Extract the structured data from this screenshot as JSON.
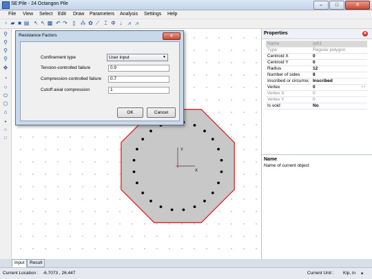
{
  "window": {
    "title": "SE:Pile - 24 Octangon Pile",
    "minimize": "–",
    "maximize": "□",
    "close": "✕"
  },
  "menu": [
    "File",
    "View",
    "Select",
    "Edit",
    "Draw",
    "Parameters",
    "Analysis",
    "Settings",
    "Help"
  ],
  "toolbar_icons": [
    "new-icon",
    "open-icon",
    "save-icon",
    "print-icon",
    "pointer-icon",
    "select-node-icon",
    "select-region-icon",
    "undo-icon",
    "redo-icon",
    "table-icon",
    "network-icon",
    "cluster-icon",
    "line-icon",
    "dimension-icon",
    "phi-icon",
    "arrow-down-icon",
    "chart-icon",
    "chart2-icon"
  ],
  "side_icons": [
    "zoom-in-icon",
    "zoom-out-icon",
    "zoom-fit-icon",
    "zoom-window-icon",
    "pan-icon",
    "rotate-icon",
    "circle-tool-icon",
    "ellipse-tool-icon",
    "polygon-tool-icon",
    "region-tool-icon",
    "point-tool-icon",
    "circle-pattern-icon",
    "grid-pattern-icon"
  ],
  "dialog": {
    "title": "Resistance Factors",
    "close": "✕",
    "fields": [
      {
        "label": "Confinement type",
        "value": "User input",
        "kind": "select"
      },
      {
        "label": "Tension-controlled failure",
        "value": "0.9",
        "kind": "input"
      },
      {
        "label": "Compression-controlled failure",
        "value": "0.7",
        "kind": "input"
      },
      {
        "label": "Cutoff axial compression",
        "value": "1",
        "kind": "input"
      }
    ],
    "ok": "OK",
    "cancel": "Cancel"
  },
  "properties": {
    "title": "Properties",
    "rows": [
      {
        "key": "Name",
        "value": "rp01",
        "dim": true,
        "sel": true
      },
      {
        "key": "Type",
        "value": "Regular polygon",
        "dim": true
      },
      {
        "key": "Centroid  X",
        "value": "0"
      },
      {
        "key": "Centroid  Y",
        "value": "0"
      },
      {
        "key": "Radius",
        "value": "12"
      },
      {
        "key": "Number of sides",
        "value": "8"
      },
      {
        "key": "Inscribed or circumscribed",
        "value": "Inscribed"
      },
      {
        "key": "Vertex",
        "value": "0",
        "spin": "‹ ›"
      },
      {
        "key": "Vertex X",
        "value": "0",
        "dim": true
      },
      {
        "key": "Vertex Y",
        "value": "0",
        "dim": true
      },
      {
        "key": "Is void",
        "value": "No"
      }
    ],
    "desc_title": "Name",
    "desc_text": "Name of current object"
  },
  "canvas": {
    "axis_x": "X",
    "axis_y": "Y",
    "polygon_sides": 8,
    "polygon_outline_color": "#e02020",
    "polygon_fill_color": "#c8c8c8",
    "pile_count": 24
  },
  "tabs": [
    "Input",
    "Result"
  ],
  "status": {
    "location_label": "Current Location :",
    "location_value": "-6.7073 , 26.447",
    "unit_label": "Current Unit :",
    "unit_value": "Kip, in",
    "unit_arrow": "▾"
  }
}
